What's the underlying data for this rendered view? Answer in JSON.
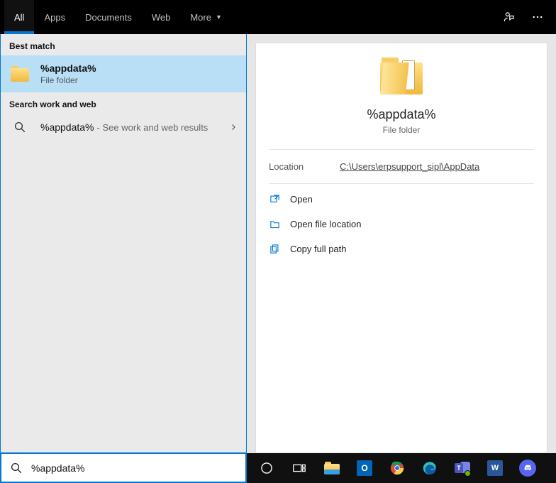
{
  "tabs": {
    "all": "All",
    "apps": "Apps",
    "documents": "Documents",
    "web": "Web",
    "more": "More"
  },
  "left": {
    "best_match_label": "Best match",
    "best_match": {
      "title": "%appdata%",
      "subtitle": "File folder"
    },
    "search_web_label": "Search work and web",
    "web_result": {
      "title": "%appdata%",
      "hint": " - See work and web results"
    }
  },
  "preview": {
    "title": "%appdata%",
    "subtitle": "File folder",
    "location_label": "Location",
    "location_path": "C:\\Users\\erpsupport_sipl\\AppData",
    "actions": {
      "open": "Open",
      "open_location": "Open file location",
      "copy_path": "Copy full path"
    }
  },
  "search": {
    "value": "%appdata%"
  }
}
